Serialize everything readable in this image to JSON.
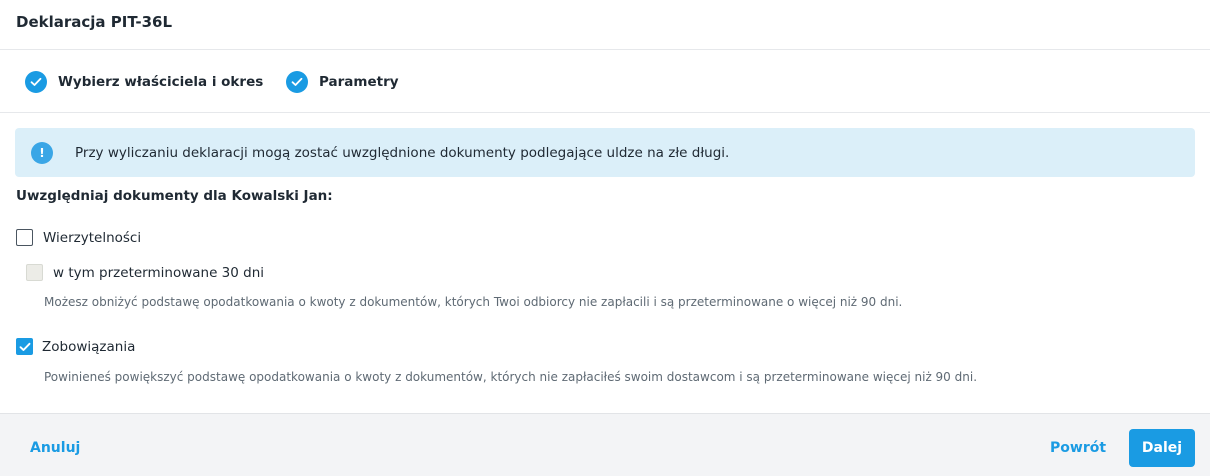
{
  "header": {
    "title": "Deklaracja PIT-36L"
  },
  "steps": [
    {
      "label": "Wybierz właściciela i okres",
      "completed": true
    },
    {
      "label": "Parametry",
      "completed": true
    }
  ],
  "alert": {
    "icon": "info-icon",
    "icon_glyph": "!",
    "text": "Przy wyliczaniu deklaracji mogą zostać uwzględnione dokumenty podlegające uldze na złe długi."
  },
  "section": {
    "title": "Uwzględniaj dokumenty dla Kowalski Jan:"
  },
  "options": {
    "receivables": {
      "label": "Wierzytelności",
      "checked": false,
      "sub_option": {
        "label": "w tym przeterminowane 30 dni",
        "checked": false,
        "disabled": true
      },
      "hint": "Możesz obniżyć podstawę opodatkowania o kwoty z dokumentów, których Twoi odbiorcy nie zapłacili i są przeterminowane o więcej niż 90 dni."
    },
    "liabilities": {
      "label": "Zobowiązania",
      "checked": true,
      "hint": "Powinieneś powiększyć podstawę opodatkowania o kwoty z dokumentów, których nie zapłaciłeś swoim dostawcom i są przeterminowane więcej niż 90 dni."
    }
  },
  "footer": {
    "cancel_label": "Anuluj",
    "back_label": "Powrót",
    "next_label": "Dalej"
  },
  "colors": {
    "accent": "#1a9be3",
    "alert_background": "#dbeff9",
    "footer_background": "#f3f4f6"
  }
}
